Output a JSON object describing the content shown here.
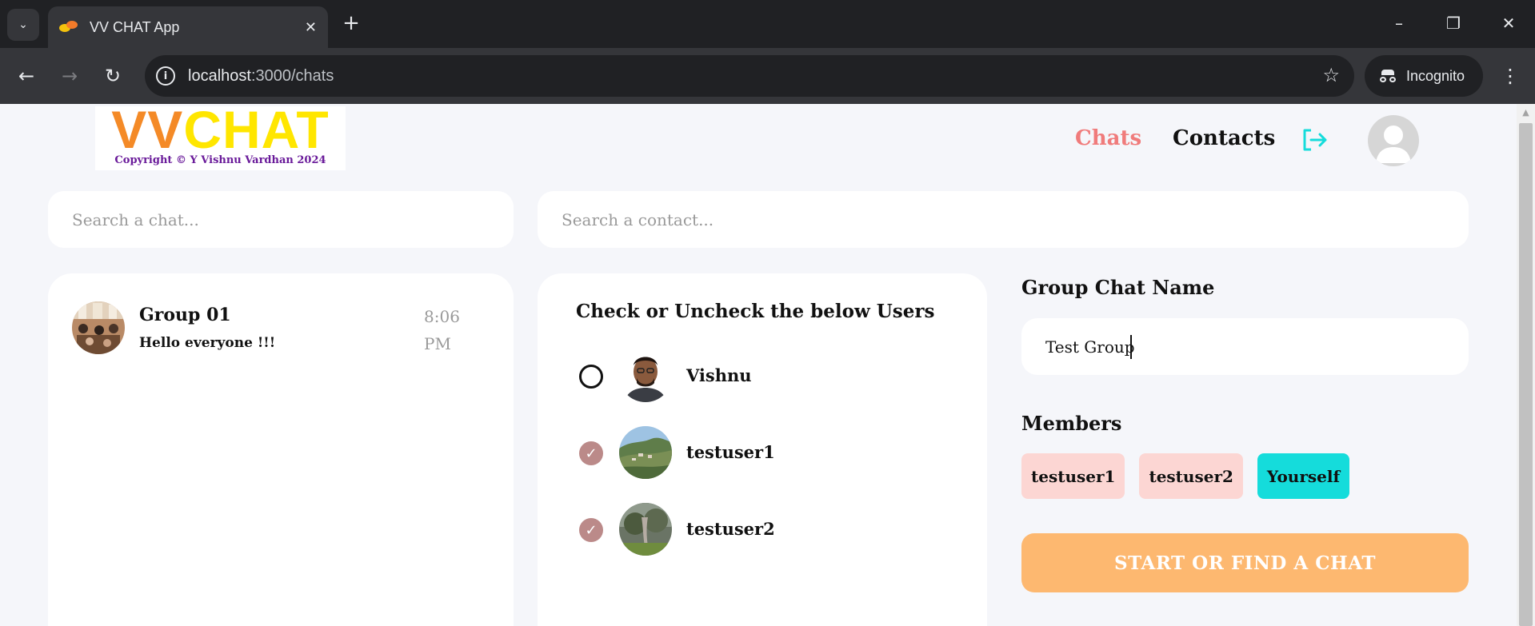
{
  "browser": {
    "tab_title": "VV CHAT App",
    "tab_close": "✕",
    "new_tab": "+",
    "url_host": "localhost",
    "url_path": ":3000/chats",
    "profile_label": "Incognito",
    "icons": [
      "tab-search-icon",
      "favicon",
      "close-icon",
      "plus-icon",
      "minimize-icon",
      "restore-icon",
      "close-window-icon",
      "back-icon",
      "forward-icon",
      "reload-icon",
      "site-info-icon",
      "star-icon",
      "incognito-icon",
      "menu-icon"
    ]
  },
  "app": {
    "logo_vv": "VV",
    "logo_chat": "CHAT",
    "logo_copyright": "Copyright © Y Vishnu Vardhan 2024",
    "nav": {
      "chats": "Chats",
      "contacts": "Contacts"
    },
    "colors": {
      "chats_active": "#f07b7b",
      "member_chip": "#fcd6d3",
      "self_chip": "#15dcdb",
      "start_button": "#fdb870",
      "checked": "#bb8a89"
    }
  },
  "search": {
    "chat_placeholder": "Search a chat...",
    "contact_placeholder": "Search a contact..."
  },
  "chats": [
    {
      "name": "Group 01",
      "last_message": "Hello everyone !!!",
      "time": "8:06 PM"
    }
  ],
  "users_panel": {
    "title": "Check or Uncheck the below Users",
    "users": [
      {
        "name": "Vishnu",
        "checked": false
      },
      {
        "name": "testuser1",
        "checked": true
      },
      {
        "name": "testuser2",
        "checked": true
      }
    ]
  },
  "group": {
    "name_label": "Group Chat Name",
    "name_value": "Test Group",
    "members_label": "Members",
    "members": [
      "testuser1",
      "testuser2",
      "Yourself"
    ],
    "start_button": "START OR FIND A CHAT"
  }
}
